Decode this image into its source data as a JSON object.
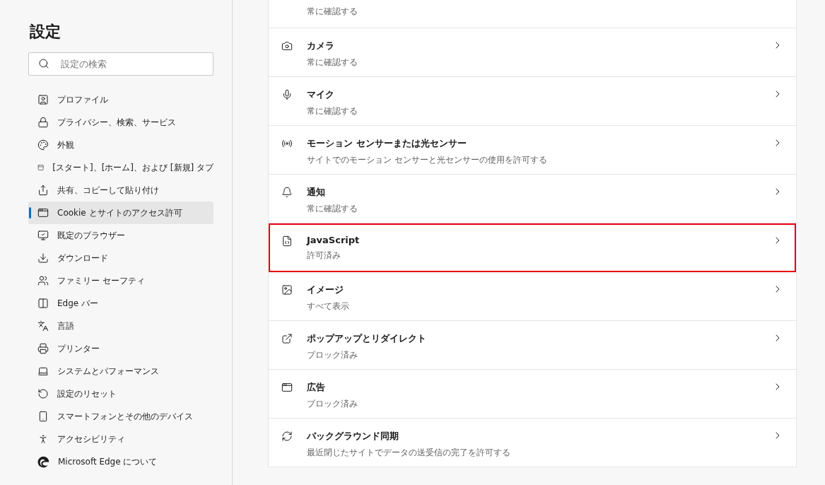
{
  "sidebar": {
    "title": "設定",
    "search": {
      "placeholder": "設定の検索"
    },
    "items": [
      {
        "label": "プロファイル",
        "selected": false
      },
      {
        "label": "プライバシー、検索、サービス",
        "selected": false
      },
      {
        "label": "外観",
        "selected": false
      },
      {
        "label": "[スタート]、[ホーム]、および [新規] タブ",
        "selected": false
      },
      {
        "label": "共有、コピーして貼り付け",
        "selected": false
      },
      {
        "label": "Cookie とサイトのアクセス許可",
        "selected": true
      },
      {
        "label": "既定のブラウザー",
        "selected": false
      },
      {
        "label": "ダウンロード",
        "selected": false
      },
      {
        "label": "ファミリー セーフティ",
        "selected": false
      },
      {
        "label": "Edge バー",
        "selected": false
      },
      {
        "label": "言語",
        "selected": false
      },
      {
        "label": "プリンター",
        "selected": false
      },
      {
        "label": "システムとパフォーマンス",
        "selected": false
      },
      {
        "label": "設定のリセット",
        "selected": false
      },
      {
        "label": "スマートフォンとその他のデバイス",
        "selected": false
      },
      {
        "label": "アクセシビリティ",
        "selected": false
      },
      {
        "label": "Microsoft Edge について",
        "selected": false
      }
    ]
  },
  "permissions": [
    {
      "kind": "partial",
      "subtitle": "常に確認する",
      "highlighted": false
    },
    {
      "kind": "full",
      "title": "カメラ",
      "subtitle": "常に確認する",
      "highlighted": false
    },
    {
      "kind": "full",
      "title": "マイク",
      "subtitle": "常に確認する",
      "highlighted": false
    },
    {
      "kind": "full",
      "title": "モーション センサーまたは光センサー",
      "subtitle": "サイトでのモーション センサーと光センサーの使用を許可する",
      "highlighted": false
    },
    {
      "kind": "full",
      "title": "通知",
      "subtitle": "常に確認する",
      "highlighted": false
    },
    {
      "kind": "full",
      "title": "JavaScript",
      "subtitle": "許可済み",
      "highlighted": true
    },
    {
      "kind": "full",
      "title": "イメージ",
      "subtitle": "すべて表示",
      "highlighted": false
    },
    {
      "kind": "full",
      "title": "ポップアップとリダイレクト",
      "subtitle": "ブロック済み",
      "highlighted": false
    },
    {
      "kind": "full",
      "title": "広告",
      "subtitle": "ブロック済み",
      "highlighted": false
    },
    {
      "kind": "full",
      "title": "バックグラウンド同期",
      "subtitle": "最近閉じたサイトでデータの送受信の完了を許可する",
      "highlighted": false
    }
  ]
}
